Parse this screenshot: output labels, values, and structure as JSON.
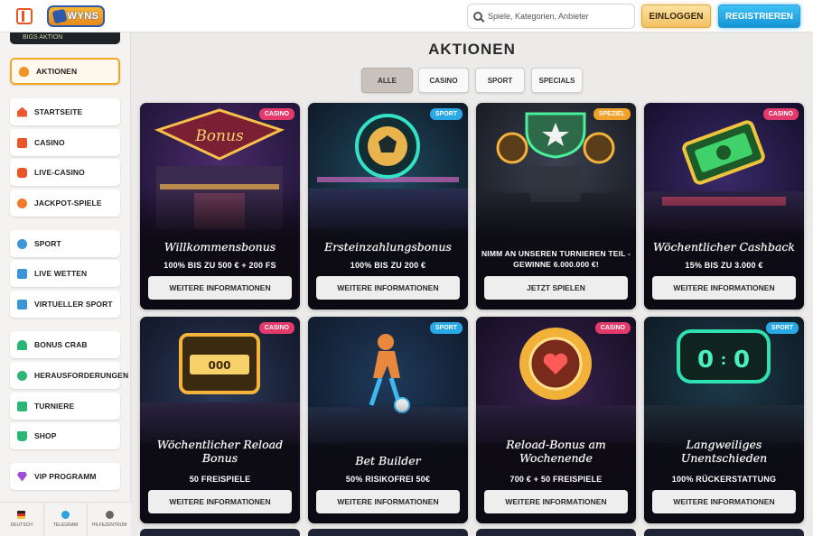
{
  "header": {
    "logo_text": "WYNS",
    "search_placeholder": "Spiele, Kategorien, Anbieter",
    "login_label": "EINLOGGEN",
    "register_label": "REGISTRIEREN"
  },
  "sidebar": {
    "top_banner": "BIGS AKTION",
    "items": [
      {
        "label": "AKTIONEN",
        "icon": "fire-icon"
      },
      {
        "label": "STARTSEITE",
        "icon": "home-icon"
      },
      {
        "label": "CASINO",
        "icon": "casino-icon"
      },
      {
        "label": "LIVE-CASINO",
        "icon": "live-casino-icon"
      },
      {
        "label": "JACKPOT-SPIELE",
        "icon": "jackpot-icon"
      },
      {
        "label": "SPORT",
        "icon": "sport-icon"
      },
      {
        "label": "LIVE WETTEN",
        "icon": "live-bet-icon"
      },
      {
        "label": "VIRTUELLER SPORT",
        "icon": "virtual-sport-icon"
      },
      {
        "label": "BONUS CRAB",
        "icon": "crab-icon"
      },
      {
        "label": "HERAUSFORDERUNGEN",
        "icon": "challenge-icon"
      },
      {
        "label": "TURNIERE",
        "icon": "tournament-icon"
      },
      {
        "label": "SHOP",
        "icon": "shop-icon"
      },
      {
        "label": "VIP PROGRAMM",
        "icon": "vip-icon"
      }
    ],
    "footer": [
      {
        "label": "DEUTSCH",
        "icon": "flag-icon"
      },
      {
        "label": "TELEGRAM",
        "icon": "telegram-icon"
      },
      {
        "label": "HILFEZENTRUM",
        "icon": "help-icon"
      }
    ]
  },
  "main": {
    "title": "AKTIONEN",
    "filters": [
      "ALLE",
      "CASINO",
      "SPORT",
      "SPECIALS"
    ],
    "active_filter": "ALLE",
    "cards": [
      {
        "badge": "CASINO",
        "title": "Willkommensbonus",
        "subtitle": "100% BIS ZU 500 € + 200 FS",
        "button": "WEITERE INFORMATIONEN"
      },
      {
        "badge": "SPORT",
        "title": "Ersteinzahlungsbonus",
        "subtitle": "100% BIS ZU 200 €",
        "button": "WEITERE INFORMATIONEN"
      },
      {
        "badge": "SPEZIEL",
        "title": "",
        "subtitle": "NIMM AN UNSEREN TURNIEREN TEIL - GEWINNE 6.000.000 €!",
        "button": "JETZT SPIELEN"
      },
      {
        "badge": "CASINO",
        "title": "Wöchentlicher Cashback",
        "subtitle": "15% BIS ZU 3.000 €",
        "button": "WEITERE INFORMATIONEN"
      },
      {
        "badge": "CASINO",
        "title": "Wöchentlicher Reload Bonus",
        "subtitle": "50 FREISPIELE",
        "button": "WEITERE INFORMATIONEN"
      },
      {
        "badge": "SPORT",
        "title": "Bet Builder",
        "subtitle": "50% RISIKOFREI 50€",
        "button": "WEITERE INFORMATIONEN"
      },
      {
        "badge": "CASINO",
        "title": "Reload-Bonus am Wochenende",
        "subtitle": "700 € + 50 FREISPIELE",
        "button": "WEITERE INFORMATIONEN"
      },
      {
        "badge": "SPORT",
        "title": "Langweiliges Unentschieden",
        "subtitle": "100% RÜCKERSTATTUNG",
        "button": "WEITERE INFORMATIONEN"
      }
    ]
  },
  "colors": {
    "accent_orange": "#f5a623",
    "register_blue": "#1593d6",
    "badge_casino": "#e23a6a",
    "badge_sport": "#29a8e6",
    "badge_specials": "#f0a12a"
  }
}
